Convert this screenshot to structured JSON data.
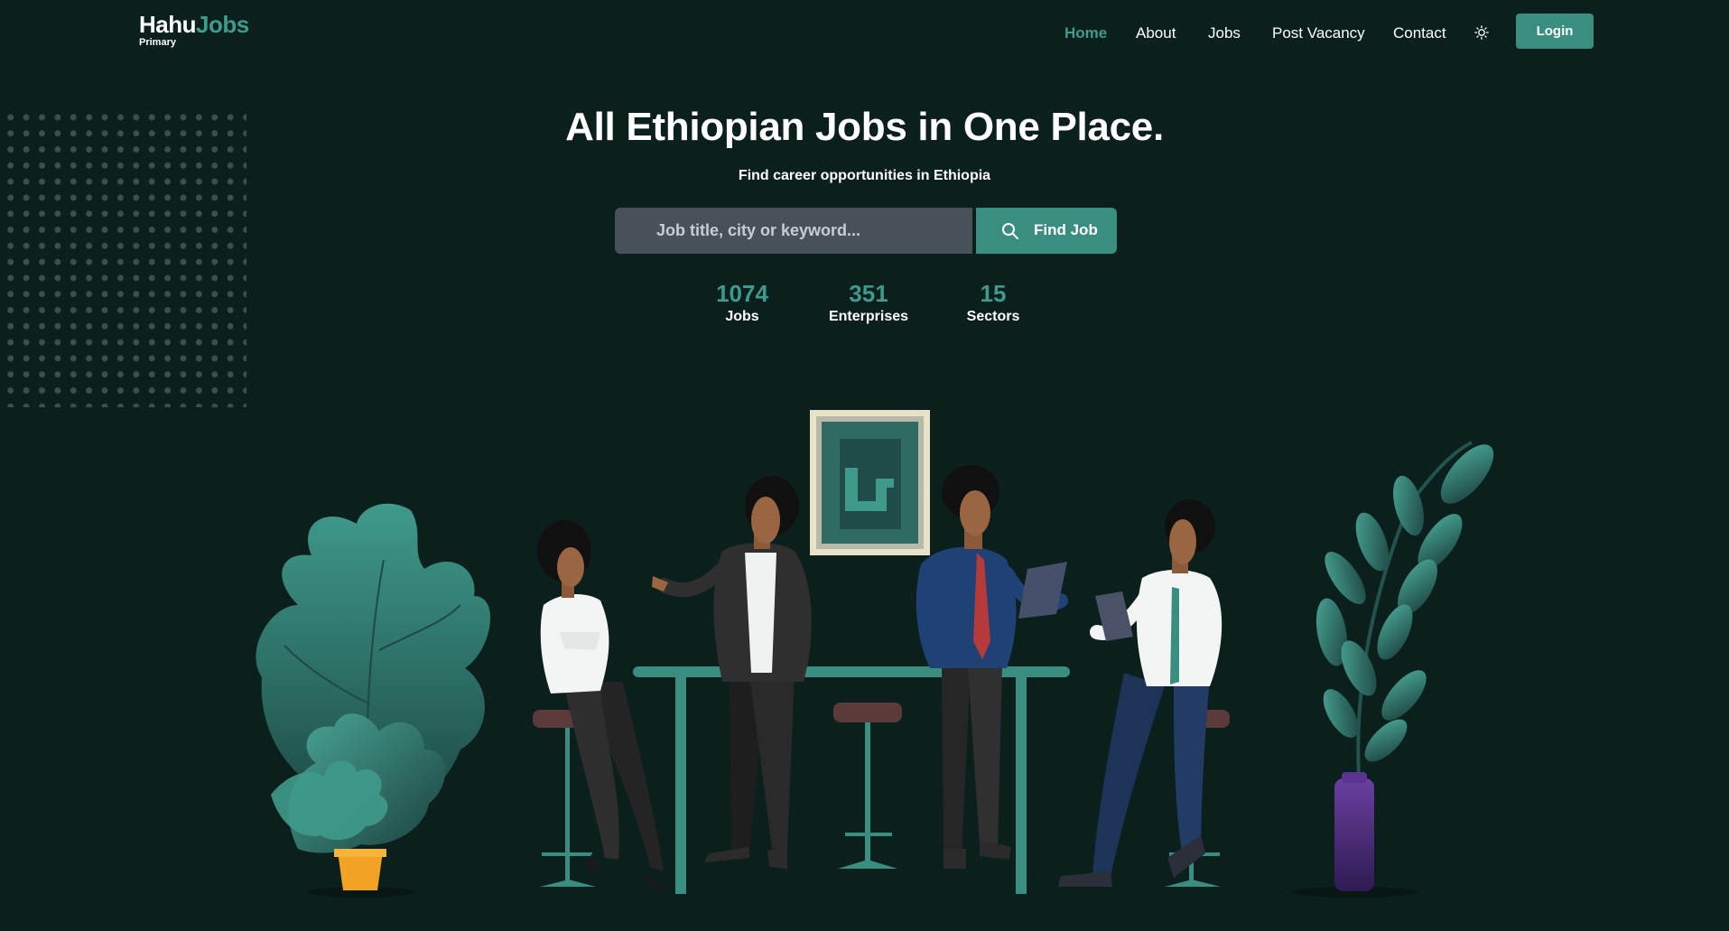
{
  "header": {
    "logo_main_1": "Hahu",
    "logo_main_2": "Jobs",
    "logo_sub": "Primary",
    "nav": [
      {
        "label": "Home",
        "active": true
      },
      {
        "label": "About"
      },
      {
        "label": "Jobs"
      },
      {
        "label": "Post Vacancy"
      },
      {
        "label": "Contact"
      }
    ],
    "theme_icon": "sun-icon",
    "login_label": "Login"
  },
  "hero": {
    "title": "All Ethiopian Jobs in One Place.",
    "subtitle": "Find career opportunities in Ethiopia",
    "search_placeholder": "Job title, city or keyword...",
    "search_value": "",
    "find_label": "Find Job",
    "search_icon": "search-icon"
  },
  "stats": [
    {
      "number": "1074",
      "label": "Jobs"
    },
    {
      "number": "351",
      "label": "Enterprises"
    },
    {
      "number": "15",
      "label": "Sectors"
    }
  ],
  "colors": {
    "background": "#0b201d",
    "accent": "#3a8e80",
    "accent_text": "#3f9a8b",
    "input_bg": "#48515a"
  }
}
